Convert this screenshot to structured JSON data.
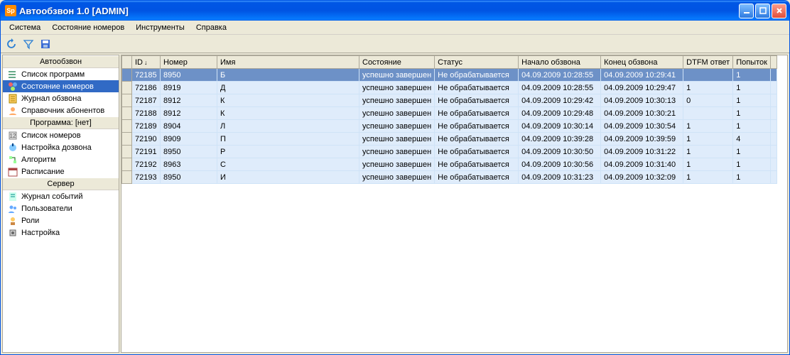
{
  "window": {
    "title": "Автообзвон 1.0 [ADMIN]"
  },
  "menu": [
    "Система",
    "Состояние номеров",
    "Инструменты",
    "Справка"
  ],
  "toolbar": {
    "refresh": "refresh",
    "filter": "filter",
    "save": "save"
  },
  "sidebar": {
    "groups": [
      {
        "title": "Автообзвон",
        "items": [
          {
            "label": "Список программ",
            "icon": "list",
            "selected": false
          },
          {
            "label": "Состояние номеров",
            "icon": "numbers-state",
            "selected": true
          },
          {
            "label": "Журнал обзвона",
            "icon": "journal",
            "selected": false
          },
          {
            "label": "Справочник абонентов",
            "icon": "contacts",
            "selected": false
          }
        ]
      },
      {
        "title": "Программа: [нет]",
        "items": [
          {
            "label": "Список номеров",
            "icon": "numbers",
            "selected": false
          },
          {
            "label": "Настройка дозвона",
            "icon": "dial-settings",
            "selected": false
          },
          {
            "label": "Алгоритм",
            "icon": "algorithm",
            "selected": false
          },
          {
            "label": "Расписание",
            "icon": "schedule",
            "selected": false
          }
        ]
      },
      {
        "title": "Сервер",
        "items": [
          {
            "label": "Журнал событий",
            "icon": "event-log",
            "selected": false
          },
          {
            "label": "Пользователи",
            "icon": "users",
            "selected": false
          },
          {
            "label": "Роли",
            "icon": "roles",
            "selected": false
          },
          {
            "label": "Настройка",
            "icon": "settings",
            "selected": false
          }
        ]
      }
    ]
  },
  "grid": {
    "columns": [
      "ID",
      "Номер",
      "Имя",
      "Состояние",
      "Статус",
      "Начало обзвона",
      "Конец обзвона",
      "DTFM ответ",
      "Попыток"
    ],
    "sort_col": 0,
    "rows": [
      {
        "selected": true,
        "cells": [
          "72185",
          "8950",
          "Б",
          "успешно завершен",
          "Не обрабатывается",
          "04.09.2009 10:28:55",
          "04.09.2009 10:29:41",
          "",
          "1"
        ]
      },
      {
        "selected": false,
        "cells": [
          "72186",
          "8919",
          "Д",
          "успешно завершен",
          "Не обрабатывается",
          "04.09.2009 10:28:55",
          "04.09.2009 10:29:47",
          "1",
          "1"
        ]
      },
      {
        "selected": false,
        "cells": [
          "72187",
          "8912",
          "К",
          "успешно завершен",
          "Не обрабатывается",
          "04.09.2009 10:29:42",
          "04.09.2009 10:30:13",
          "0",
          "1"
        ]
      },
      {
        "selected": false,
        "cells": [
          "72188",
          "8912",
          "К",
          "успешно завершен",
          "Не обрабатывается",
          "04.09.2009 10:29:48",
          "04.09.2009 10:30:21",
          "",
          "1"
        ]
      },
      {
        "selected": false,
        "cells": [
          "72189",
          "8904",
          "Л",
          "успешно завершен",
          "Не обрабатывается",
          "04.09.2009 10:30:14",
          "04.09.2009 10:30:54",
          "1",
          "1"
        ]
      },
      {
        "selected": false,
        "cells": [
          "72190",
          "8909",
          "П",
          "успешно завершен",
          "Не обрабатывается",
          "04.09.2009 10:39:28",
          "04.09.2009 10:39:59",
          "1",
          "4"
        ]
      },
      {
        "selected": false,
        "cells": [
          "72191",
          "8950",
          "Р",
          "успешно завершен",
          "Не обрабатывается",
          "04.09.2009 10:30:50",
          "04.09.2009 10:31:22",
          "1",
          "1"
        ]
      },
      {
        "selected": false,
        "cells": [
          "72192",
          "8963",
          "С",
          "успешно завершен",
          "Не обрабатывается",
          "04.09.2009 10:30:56",
          "04.09.2009 10:31:40",
          "1",
          "1"
        ]
      },
      {
        "selected": false,
        "cells": [
          "72193",
          "8950",
          "И",
          "успешно завершен",
          "Не обрабатывается",
          "04.09.2009 10:31:23",
          "04.09.2009 10:32:09",
          "1",
          "1"
        ]
      }
    ]
  }
}
